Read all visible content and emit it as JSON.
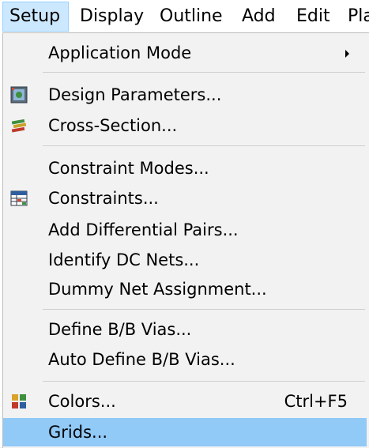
{
  "menubar": {
    "items": [
      {
        "label": "Setup"
      },
      {
        "label": "Display"
      },
      {
        "label": "Outline"
      },
      {
        "label": "Add"
      },
      {
        "label": "Edit"
      },
      {
        "label": "Pla"
      }
    ]
  },
  "menu": {
    "items": [
      {
        "label": "Application Mode",
        "submenu": true
      },
      {
        "label": "Design Parameters...",
        "icon": "design-parameters-icon"
      },
      {
        "label": "Cross-Section...",
        "icon": "cross-section-icon"
      },
      {
        "label": "Constraint Modes..."
      },
      {
        "label": "Constraints...",
        "icon": "constraints-icon"
      },
      {
        "label": "Add Differential Pairs..."
      },
      {
        "label": "Identify DC Nets..."
      },
      {
        "label": "Dummy Net Assignment..."
      },
      {
        "label": "Define B/B Vias..."
      },
      {
        "label": "Auto Define B/B Vias..."
      },
      {
        "label": "Colors...",
        "shortcut": "Ctrl+F5",
        "icon": "colors-icon"
      },
      {
        "label": "Grids...",
        "highlighted": true
      }
    ]
  },
  "colors": {
    "highlight": "#91c9f7",
    "menubar_active": "#cce8ff",
    "menu_background": "#f2f2f2"
  }
}
